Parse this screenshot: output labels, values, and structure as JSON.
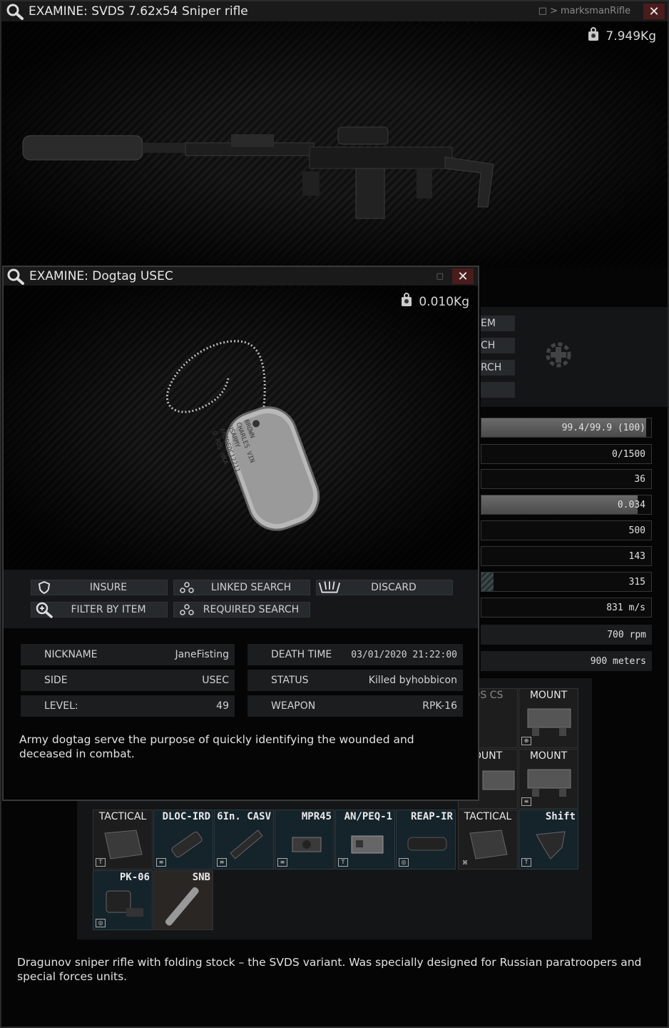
{
  "rifle_window": {
    "title": "EXAMINE: SVDS 7.62x54 Sniper rifle",
    "breadcrumb": "□ > marksmanRifle",
    "close": "✕",
    "weight": "7.949Kg",
    "description": "Dragunov sniper rifle with folding stock – the SVDS variant. Was specially designed for Russian paratroopers and special forces units.",
    "side_buttons": [
      "EM",
      "CH",
      "RCH",
      ""
    ],
    "stats": [
      {
        "value": "99.4/99.9 (100)",
        "fill": 0.97
      },
      {
        "value": "0/1500"
      },
      {
        "value": "36"
      },
      {
        "value": "0.034",
        "fill": 0.92
      },
      {
        "value": "500"
      },
      {
        "value": "143"
      },
      {
        "value": "315",
        "fill": 0.06
      },
      {
        "value": "831 m/s"
      },
      {
        "value": "700 rpm"
      },
      {
        "value": "900 meters"
      }
    ],
    "slots_row1": [
      {
        "name": "DS CS"
      },
      {
        "name": "MOUNT"
      }
    ],
    "slots_row2": [
      {
        "name": "OUNT"
      },
      {
        "name": "MOUNT"
      }
    ],
    "slots_row3": [
      {
        "name": "TACTICAL"
      },
      {
        "name": "DLOC-IRD"
      },
      {
        "name": "6In. CASV"
      },
      {
        "name": "MPR45"
      },
      {
        "name": "AN/PEQ-1"
      },
      {
        "name": "REAP-IR"
      },
      {
        "name": "TACTICAL"
      },
      {
        "name": "Shift"
      }
    ],
    "slots_row4": [
      {
        "name": "PK-06"
      },
      {
        "name": "SNB"
      }
    ]
  },
  "dogtag_window": {
    "title": "EXAMINE: Dogtag USEC",
    "close": "✕",
    "weight": "0.010Kg",
    "engraving": [
      "BROWN",
      "CHARLES VIN",
      "USARMY",
      "AMEDEOC12211",
      "O POS NKA"
    ],
    "actions": {
      "insure": "INSURE",
      "linked_search": "LINKED SEARCH",
      "discard": "DISCARD",
      "filter_by_item": "FILTER BY ITEM",
      "required_search": "REQUIRED SEARCH"
    },
    "info": {
      "nickname_label": "NICKNAME",
      "nickname": "JaneFisting",
      "side_label": "SIDE",
      "side": "USEC",
      "level_label": "LEVEL:",
      "level": "49",
      "death_time_label": "DEATH TIME",
      "death_time": "03/01/2020 21:22:00",
      "status_label": "STATUS",
      "status": "Killed byhobbicon",
      "weapon_label": "WEAPON",
      "weapon": "RPK-16"
    },
    "description": "Army dogtag serve the purpose of quickly identifying the wounded and deceased in combat."
  }
}
